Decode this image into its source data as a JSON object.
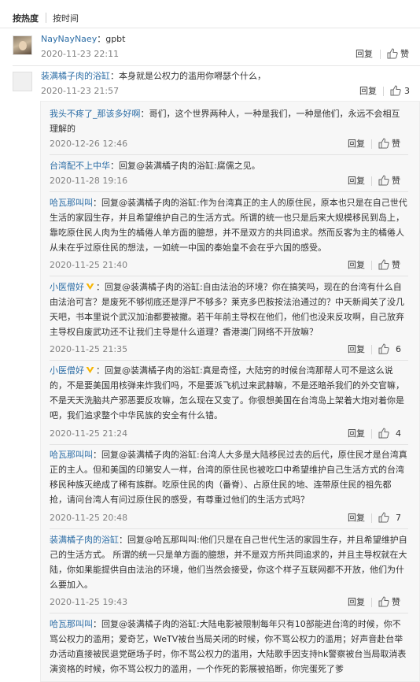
{
  "sort": {
    "hot": "按热度",
    "time": "按时间"
  },
  "actions": {
    "reply": "回复",
    "like": "赞"
  },
  "top_comments": [
    {
      "user": "NayNayNaey",
      "text": "：gpbt",
      "timestamp": "2020-11-23 22:11",
      "likes": "赞"
    },
    {
      "user": "装满橘子肉的浴缸",
      "text": "：本身就是公权力的滥用你嘚瑟个什么，",
      "timestamp": "2020-11-23 21:57",
      "likes": "3"
    }
  ],
  "replies": [
    {
      "user": "我头不疼了_那该多好啊",
      "lines": [
        "：哥们，这个世界两种人，一种是我们，一种是他们，永远不会相互",
        "理解的"
      ],
      "timestamp": "2020-12-26 12:46",
      "likes": "赞"
    },
    {
      "user": "台湾配不上中华",
      "lines": [
        "：回复@装满橘子肉的浴缸:腐儒之见。"
      ],
      "timestamp": "2020-11-28 19:16",
      "likes": "赞"
    },
    {
      "user": "哈瓦那叫叫",
      "lines": [
        "：回复@装满橘子肉的浴缸:作为台湾真正的主人的原住民，原本也只是在自己世代",
        "生活的家园生存，并且希望维护自己的生活方式。所谓的统一也只是后来大规模移民到岛上，",
        "靠吃原住民人肉为生的橘倦人单方面的臆想，并不是双方的共同追求。然而反客为主的橘倦人",
        "从未在乎过原住民的想法，一如统一中国的秦始皇不会在乎六国的感受。"
      ],
      "timestamp": "2020-11-25 21:40",
      "likes": "赞"
    },
    {
      "user": "小医僧好",
      "lines": [
        "：回复@装满橘子肉的浴缸:自由法治的环境？你在搞笑吗，现在的台湾有什么自",
        "由法治可言？是废死不够彻底还是浮尸不够多？莱克多巴胺按法治通过的？中天新闻关了没几",
        "天吧，书本里说个武汉加油都要被撤。若干年前主导权在他们，他们也没来反攻啊，自己放弃",
        "主导权自废武功还不让我们主导是什么道理？香港澳门网络不开放嘛？"
      ],
      "timestamp": "2020-11-25 21:35",
      "likes": "6"
    },
    {
      "user": "小医僧好",
      "lines": [
        "：回复@装满橘子肉的浴缸:真是奇怪，大陆穷的时候台湾那帮人可不是这么说",
        "的，不是要美国用核弹来炸我们吗，不是要派飞机过来武赫嘛，不是还暗杀我们的外交官嘛，",
        "不是天天洗脑共产邪恶要反攻嘛，怎么现在又变了。你很想美国在台湾岛上架着大炮对着你是",
        "吧，我们追求整个中华民族的安全有什么错。"
      ],
      "timestamp": "2020-11-25 21:24",
      "likes": "4"
    },
    {
      "user": "哈瓦那叫叫",
      "lines": [
        "：回复@装满橘子肉的浴缸:台湾人大多是大陆移民过去的后代，原住民才是台湾真",
        "正的主人。但和美国的印第安人一样，台湾的原住民也被吃口中希望维护自己生活方式的台湾",
        "移民种族灭绝成了稀有族群。吃原住民的肉（番脊）、占原住民的地、连带原住民的祖先都",
        "抢，请问台湾人有问过原住民的感受，有尊重过他们的生活方式吗？"
      ],
      "timestamp": "2020-11-25 20:48",
      "likes": "7"
    },
    {
      "user": "装满橘子肉的浴缸",
      "lines": [
        "：回复@哈瓦那叫叫:他们只是在自己世代生活的家园生存，并且希望维护自",
        "己的生活方式。 所谓的统一只是单方面的臆想，并不是双方所共同追求的，并且主导权就在大",
        "陆，你如果能提供自由法治的环境，他们当然会接受，你这个样子互联网都不开放，他们为什",
        "么要加入。"
      ],
      "timestamp": "2020-11-25 19:43",
      "likes": "赞"
    },
    {
      "user": "哈瓦那叫叫",
      "lines": [
        "：回复@装满橘子肉的浴缸:大陆电影被限制每年只有10部能进台湾的时候，你不",
        "骂公权力的滥用；爱奇艺，WeTV被台当局关闭的时候，你不骂公权力的滥用；好声音赴台举",
        "办活动直接被民退党砸场子时，你不骂公权力的滥用，大陆歌手因支持hk警察被台当局取消表",
        "演资格的时候，你不骂公权力的滥用，一个作死的影展被掐断，你完蛋死了爹"
      ],
      "timestamp": "",
      "likes": ""
    }
  ]
}
